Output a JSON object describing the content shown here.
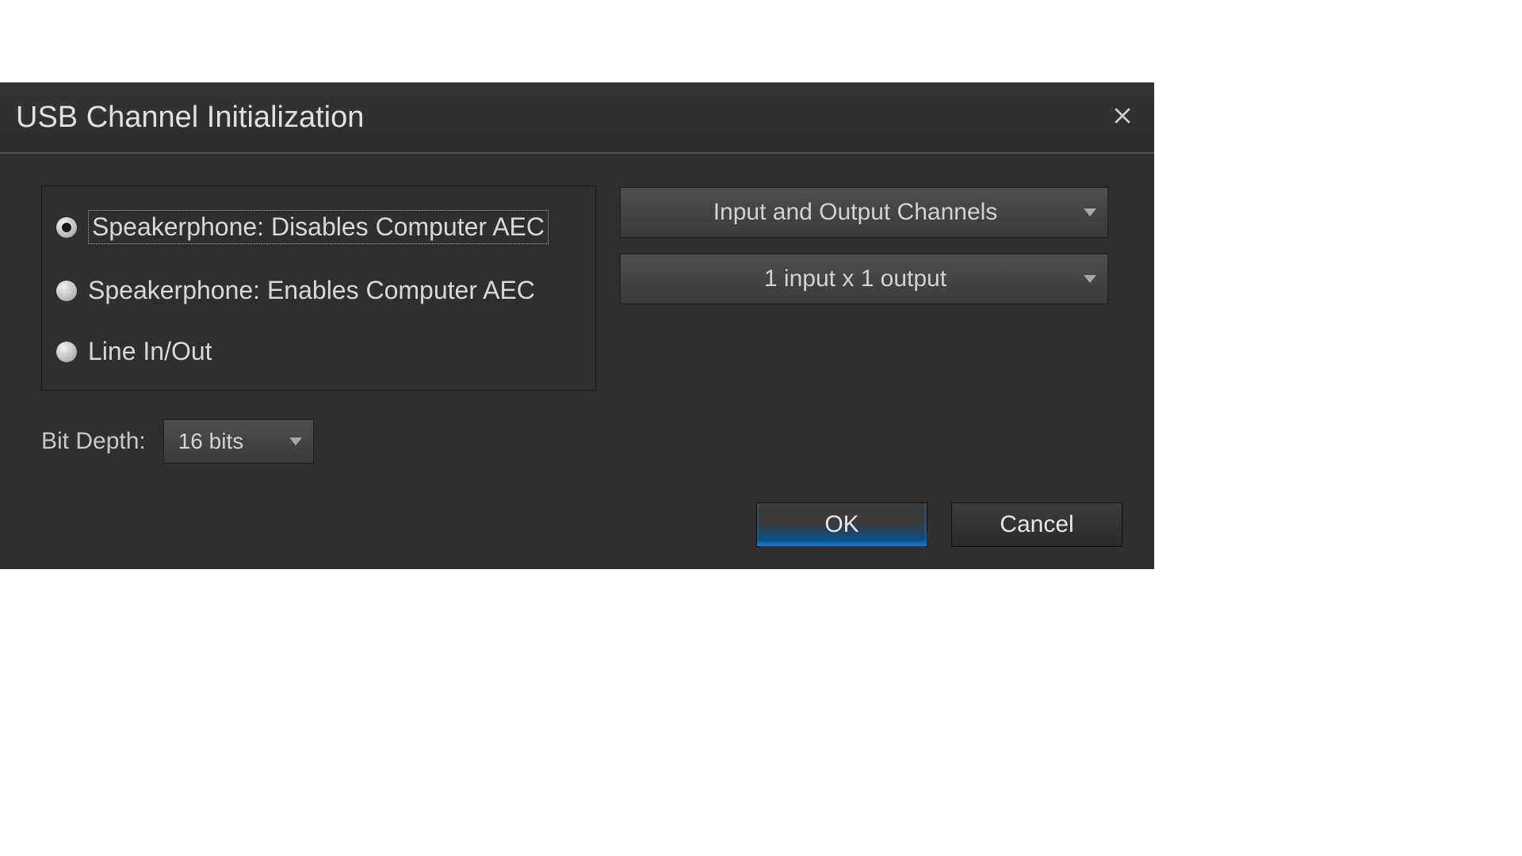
{
  "dialog": {
    "title": "USB Channel Initialization",
    "radios": {
      "option1": "Speakerphone: Disables Computer AEC",
      "option2": "Speakerphone: Enables Computer AEC",
      "option3": "Line In/Out",
      "selected_index": 0
    },
    "bit_depth": {
      "label": "Bit Depth:",
      "value": "16 bits"
    },
    "dropdowns": {
      "channels_mode": "Input and Output Channels",
      "channels_count": "1 input x 1 output"
    },
    "buttons": {
      "ok": "OK",
      "cancel": "Cancel"
    }
  }
}
